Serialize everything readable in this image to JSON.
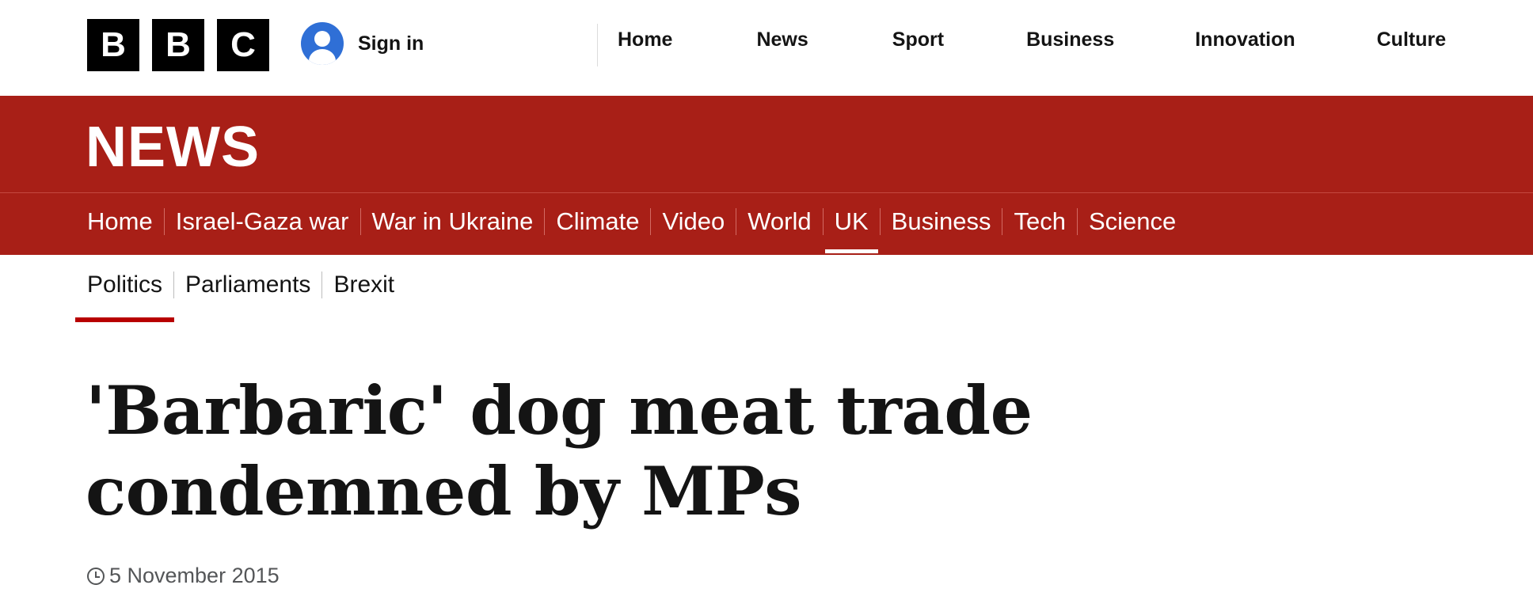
{
  "header": {
    "logo_letters": [
      "B",
      "B",
      "C"
    ],
    "signin_label": "Sign in",
    "nav": [
      "Home",
      "News",
      "Sport",
      "Business",
      "Innovation",
      "Culture"
    ]
  },
  "news": {
    "wordmark": "NEWS",
    "section_nav": [
      "Home",
      "Israel-Gaza war",
      "War in Ukraine",
      "Climate",
      "Video",
      "World",
      "UK",
      "Business",
      "Tech",
      "Science"
    ],
    "active_section": "UK",
    "sub_nav": [
      "Politics",
      "Parliaments",
      "Brexit"
    ],
    "active_sub": "Politics"
  },
  "article": {
    "headline": "'Barbaric' dog meat trade condemned by MPs",
    "date": "5 November 2015"
  },
  "colors": {
    "brand_red": "#a81f17",
    "active_underline": "#b80000"
  },
  "icons": {
    "signin": "user-avatar-icon",
    "date": "clock-icon"
  }
}
